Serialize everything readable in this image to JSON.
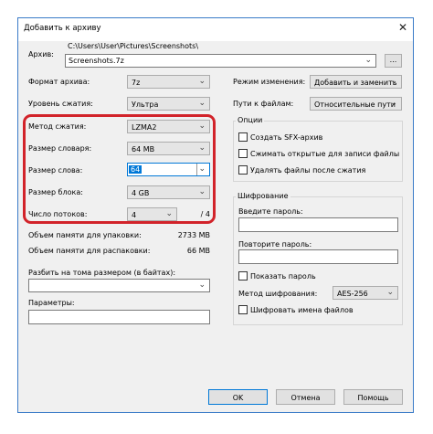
{
  "window": {
    "title": "Добавить к архиву",
    "close_glyph": "✕"
  },
  "archive": {
    "label": "Архив:",
    "path": "C:\\Users\\User\\Pictures\\Screenshots\\",
    "name": "Screenshots.7z",
    "browse": "..."
  },
  "left": {
    "format": {
      "label": "Формат архива:",
      "value": "7z"
    },
    "level": {
      "label": "Уровень сжатия:",
      "value": "Ультра"
    },
    "method": {
      "label": "Метод сжатия:",
      "value": "LZMA2"
    },
    "dict": {
      "label": "Размер словаря:",
      "value": "64 MB"
    },
    "word": {
      "label": "Размер слова:",
      "value": "64"
    },
    "block": {
      "label": "Размер блока:",
      "value": "4 GB"
    },
    "threads": {
      "label": "Число потоков:",
      "value": "4",
      "max": "/ 4"
    },
    "mem_pack": {
      "label": "Объем памяти для упаковки:",
      "value": "2733 MB"
    },
    "mem_unpack": {
      "label": "Объем памяти для распаковки:",
      "value": "66 MB"
    },
    "split": {
      "label": "Разбить на тома размером (в байтах):",
      "value": ""
    },
    "params": {
      "label": "Параметры:",
      "value": ""
    }
  },
  "right": {
    "update": {
      "label": "Режим изменения:",
      "value": "Добавить и заменить"
    },
    "paths": {
      "label": "Пути к файлам:",
      "value": "Относительные пути"
    },
    "options": {
      "title": "Опции",
      "sfx": "Создать SFX-архив",
      "shared": "Сжимать открытые для записи файлы",
      "delete": "Удалять файлы после сжатия"
    },
    "encryption": {
      "title": "Шифрование",
      "password_label": "Введите пароль:",
      "repeat_label": "Повторите пароль:",
      "show_password": "Показать пароль",
      "method_label": "Метод шифрования:",
      "method_value": "AES-256",
      "encrypt_names": "Шифровать имена файлов"
    }
  },
  "buttons": {
    "ok": "OK",
    "cancel": "Отмена",
    "help": "Помощь"
  },
  "colors": {
    "highlight": "#d2232a",
    "accent": "#0078d7"
  }
}
